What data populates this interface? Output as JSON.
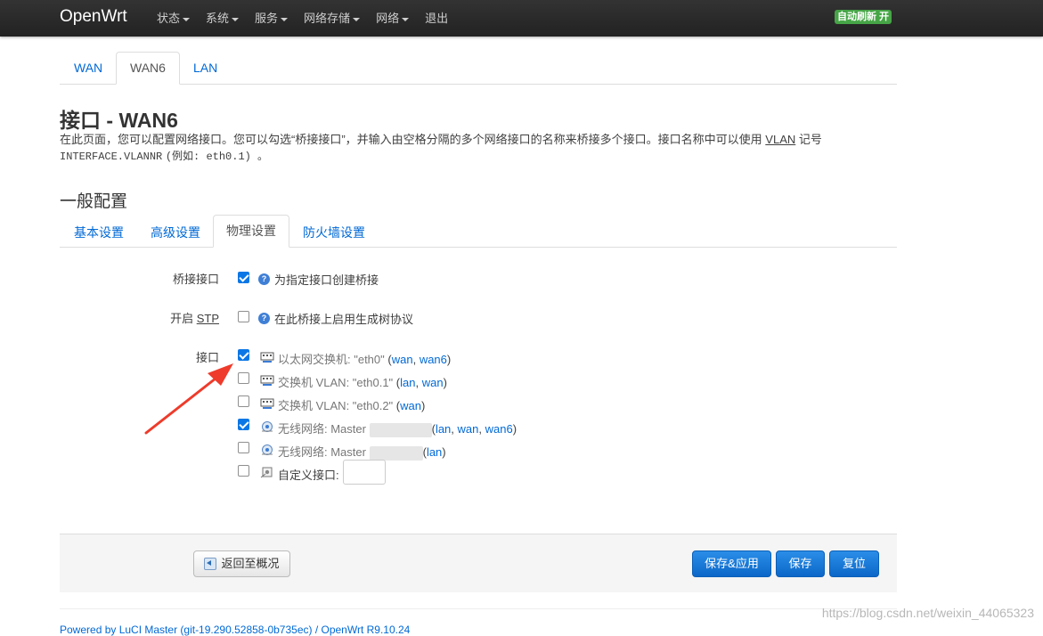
{
  "navbar": {
    "brand": "OpenWrt",
    "menu": [
      "状态",
      "系统",
      "服务",
      "网络存储",
      "网络",
      "退出"
    ],
    "auto_refresh": "自动刷新 开"
  },
  "top_tabs": [
    "WAN",
    "WAN6",
    "LAN"
  ],
  "page": {
    "title": "接口 - WAN6",
    "desc_part1": "在此页面，您可以配置网络接口。您可以勾选“桥接接口”，并输入由空格分隔的多个网络接口的名称来桥接多个接口。接口名称中可以使用",
    "desc_abbr": "VLAN",
    "desc_part2": "记号",
    "desc_code": "INTERFACE.VLANNR",
    "desc_part3": "(例如: eth0.1) 。",
    "section_title": "一般配置"
  },
  "sub_tabs": [
    "基本设置",
    "高级设置",
    "物理设置",
    "防火墙设置"
  ],
  "form": {
    "bridge": {
      "label": "桥接接口",
      "checked": true,
      "text": "为指定接口创建桥接"
    },
    "stp": {
      "label_prefix": "开启",
      "label_abbr": "STP",
      "checked": false,
      "text": "在此桥接上启用生成树协议"
    },
    "interface_label": "接口",
    "interfaces": [
      {
        "name": "以太网交换机: \"eth0\"",
        "open": " (",
        "nets": [
          "wan",
          "wan6"
        ],
        "close": ")",
        "checked": true,
        "icon": "ethernet-icon"
      },
      {
        "name": "交换机 VLAN: \"eth0.1\"",
        "open": " (",
        "nets": [
          "lan",
          "wan"
        ],
        "close": ")",
        "checked": false,
        "icon": "ethernet-icon"
      },
      {
        "name": "交换机 VLAN: \"eth0.2\"",
        "open": " (",
        "nets": [
          "wan"
        ],
        "close": ")",
        "checked": false,
        "icon": "ethernet-icon"
      },
      {
        "name": "无线网络: Master",
        "open": "(",
        "nets": [
          "lan",
          "wan",
          "wan6"
        ],
        "close": ")",
        "checked": true,
        "icon": "wifi-icon"
      },
      {
        "name": "无线网络: Master",
        "open": "(",
        "nets": [
          "lan"
        ],
        "close": ")",
        "checked": false,
        "icon": "wifi-icon"
      }
    ],
    "custom": {
      "label": "自定义接口:",
      "checked": false,
      "value": ""
    }
  },
  "actions": {
    "back": "返回至概况",
    "save_apply": "保存&应用",
    "save": "保存",
    "reset": "复位"
  },
  "footer": {
    "powered": "Powered by LuCI Master (git-19.290.52858-0b735ec) / OpenWrt R9.10.24"
  },
  "watermark": "https://blog.csdn.net/weixin_44065323"
}
